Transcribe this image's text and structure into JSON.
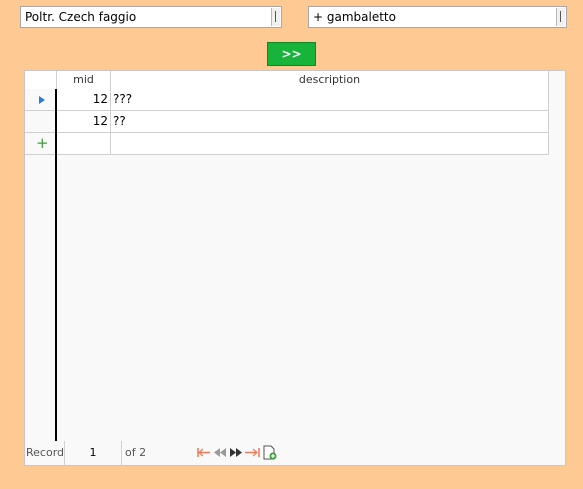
{
  "filters": {
    "left_value": "Poltr. Czech faggio",
    "right_value": "+ gambaletto",
    "go_label": ">>"
  },
  "grid": {
    "columns": [
      "mid",
      "description"
    ],
    "rows": [
      {
        "mid": "12",
        "description": "???"
      },
      {
        "mid": "12",
        "description": "??"
      }
    ]
  },
  "navigation": {
    "record_label": "Record",
    "current": "1",
    "of_text": "of 2",
    "icons": [
      "first-record-icon",
      "previous-record-icon",
      "next-record-icon",
      "last-record-icon",
      "new-record-icon"
    ]
  },
  "colors": {
    "background": "#ffc993",
    "go_button": "#17b33a",
    "current_row_indicator": "#2a7dd4",
    "new_row_indicator": "#3aa03a"
  }
}
